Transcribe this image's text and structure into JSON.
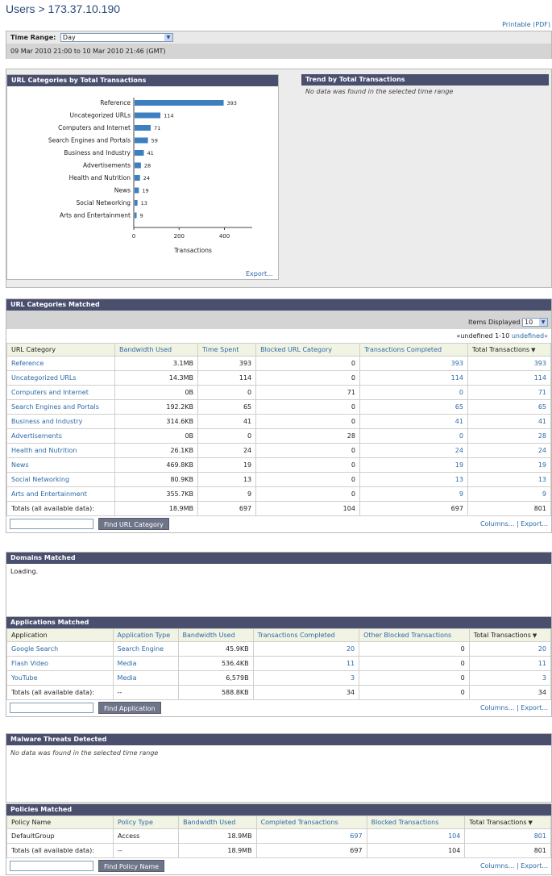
{
  "page": {
    "title": "Users > 173.37.10.190",
    "printable": "Printable (PDF)"
  },
  "time_range": {
    "label": "Time Range:",
    "value": "Day",
    "range_text": "09 Mar 2010 21:00 to 10 Mar 2010 21:46 (GMT)"
  },
  "url_chart": {
    "title": "URL Categories by Total Transactions",
    "export": "Export..."
  },
  "trend": {
    "title": "Trend by Total Transactions",
    "message": "No data was found in the selected time range"
  },
  "chart_data": {
    "type": "bar",
    "orientation": "horizontal",
    "categories": [
      "Reference",
      "Uncategorized URLs",
      "Computers and Internet",
      "Search Engines and Portals",
      "Business and Industry",
      "Advertisements",
      "Health and Nutrition",
      "News",
      "Social Networking",
      "Arts and Entertainment"
    ],
    "values": [
      393,
      114,
      71,
      59,
      41,
      28,
      24,
      19,
      13,
      9
    ],
    "xlabel": "Transactions",
    "xlim": [
      0,
      480
    ],
    "xticks": [
      "0",
      "200",
      "400"
    ],
    "bar_color": "#3d7fbf"
  },
  "url_matched": {
    "title": "URL Categories Matched",
    "items_label": "Items Displayed",
    "items_value": "10",
    "pager_left": "«undefined 1-10",
    "pager_right": "undefined»",
    "headers": [
      "URL Category",
      "Bandwidth Used",
      "Time Spent",
      "Blocked URL Category",
      "Transactions Completed",
      "Total Transactions"
    ],
    "rows": [
      [
        "Reference",
        "3.1MB",
        "393",
        "0",
        "393",
        "393"
      ],
      [
        "Uncategorized URLs",
        "14.3MB",
        "114",
        "0",
        "114",
        "114"
      ],
      [
        "Computers and Internet",
        "0B",
        "0",
        "71",
        "0",
        "71"
      ],
      [
        "Search Engines and Portals",
        "192.2KB",
        "65",
        "0",
        "65",
        "65"
      ],
      [
        "Business and Industry",
        "314.6KB",
        "41",
        "0",
        "41",
        "41"
      ],
      [
        "Advertisements",
        "0B",
        "0",
        "28",
        "0",
        "28"
      ],
      [
        "Health and Nutrition",
        "26.1KB",
        "24",
        "0",
        "24",
        "24"
      ],
      [
        "News",
        "469.8KB",
        "19",
        "0",
        "19",
        "19"
      ],
      [
        "Social Networking",
        "80.9KB",
        "13",
        "0",
        "13",
        "13"
      ],
      [
        "Arts and Entertainment",
        "355.7KB",
        "9",
        "0",
        "9",
        "9"
      ]
    ],
    "totals": [
      "Totals (all available data):",
      "18.9MB",
      "697",
      "104",
      "697",
      "801"
    ],
    "find_button": "Find URL Category",
    "columns_export": "Columns... | Export..."
  },
  "domains": {
    "title": "Domains Matched",
    "loading": "Loading."
  },
  "apps": {
    "title": "Applications Matched",
    "headers": [
      "Application",
      "Application Type",
      "Bandwidth Used",
      "Transactions Completed",
      "Other Blocked Transactions",
      "Total Transactions"
    ],
    "rows": [
      [
        "Google Search",
        "Search Engine",
        "45.9KB",
        "20",
        "0",
        "20"
      ],
      [
        "Flash Video",
        "Media",
        "536.4KB",
        "11",
        "0",
        "11"
      ],
      [
        "YouTube",
        "Media",
        "6,579B",
        "3",
        "0",
        "3"
      ]
    ],
    "totals": [
      "Totals (all available data):",
      "--",
      "588.8KB",
      "34",
      "0",
      "34"
    ],
    "find_button": "Find Application",
    "columns_export": "Columns... | Export..."
  },
  "malware": {
    "title": "Malware Threats Detected",
    "message": "No data was found in the selected time range"
  },
  "policies": {
    "title": "Policies Matched",
    "headers": [
      "Policy Name",
      "Policy Type",
      "Bandwidth Used",
      "Completed Transactions",
      "Blocked Transactions",
      "Total Transactions"
    ],
    "rows": [
      [
        "DefaultGroup",
        "Access",
        "18.9MB",
        "697",
        "104",
        "801"
      ]
    ],
    "totals": [
      "Totals (all available data):",
      "--",
      "18.9MB",
      "697",
      "104",
      "801"
    ],
    "find_button": "Find Policy Name",
    "columns_export": "Columns... | Export..."
  }
}
